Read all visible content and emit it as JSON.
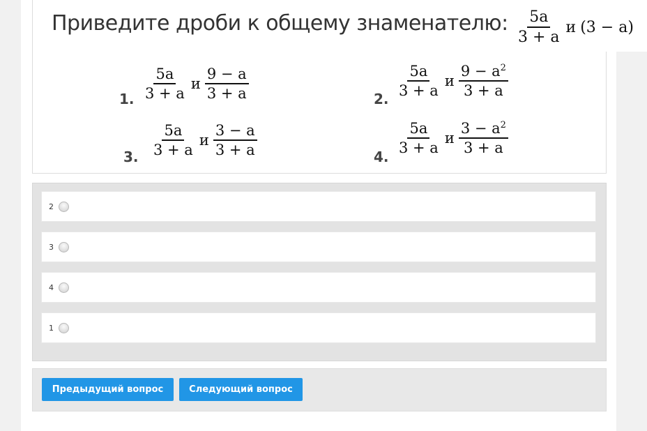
{
  "question": {
    "prompt": "Приведите дроби к общему знаменателю:",
    "fraction": {
      "num": "5a",
      "den": "3 + a"
    },
    "conj": "и",
    "expression": "(3 − a)"
  },
  "options": [
    {
      "label": "1.",
      "left": {
        "num": "5a",
        "den": "3 + a"
      },
      "conj": "и",
      "right_num_base": "9 − a",
      "right_num_exp": "",
      "right_den": "3 + a"
    },
    {
      "label": "2.",
      "left": {
        "num": "5a",
        "den": "3 + a"
      },
      "conj": "и",
      "right_num_base": "9 − a",
      "right_num_exp": "2",
      "right_den": "3 + a"
    },
    {
      "label": "3.",
      "left": {
        "num": "5a",
        "den": "3 + a"
      },
      "conj": "и",
      "right_num_base": "3 − a",
      "right_num_exp": "",
      "right_den": "3 + a"
    },
    {
      "label": "4.",
      "left": {
        "num": "5a",
        "den": "3 + a"
      },
      "conj": "и",
      "right_num_base": "3 − a",
      "right_num_exp": "2",
      "right_den": "3 + a"
    }
  ],
  "answers": [
    {
      "label": "2"
    },
    {
      "label": "3"
    },
    {
      "label": "4"
    },
    {
      "label": "1"
    }
  ],
  "nav": {
    "prev_label": "Предыдущий вопрос",
    "next_label": "Следующий вопрос",
    "button_color": "#2196e6"
  }
}
